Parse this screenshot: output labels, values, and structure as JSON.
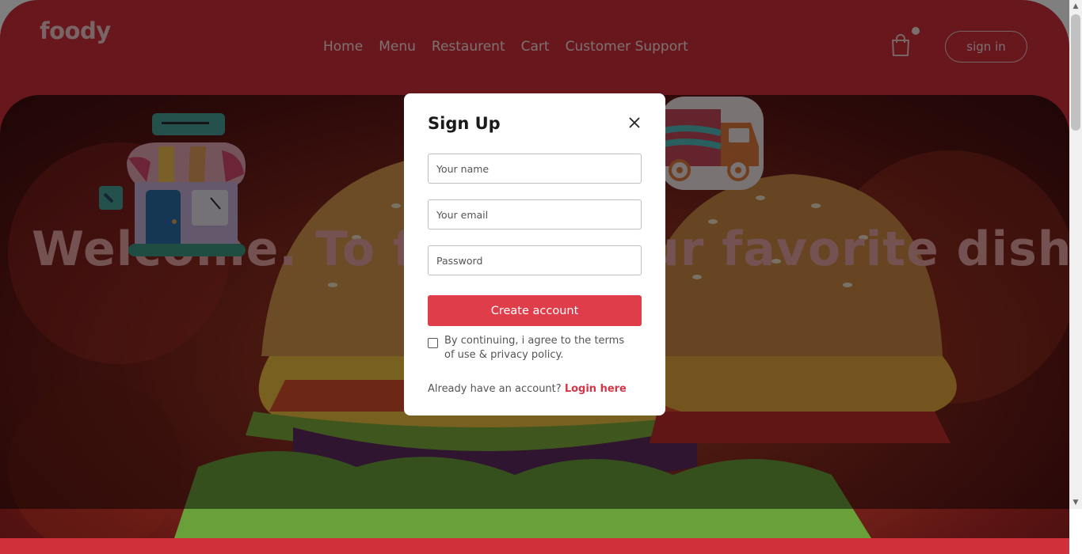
{
  "header": {
    "logo": "foody",
    "nav": [
      "Home",
      "Menu",
      "Restaurent",
      "Cart",
      "Customer Support"
    ],
    "signin_label": "sign in"
  },
  "hero": {
    "title": "Welcome. To foody, your favorite dishes"
  },
  "modal": {
    "title": "Sign Up",
    "name_placeholder": "Your name",
    "email_placeholder": "Your email",
    "password_placeholder": "Password",
    "create_label": "Create account",
    "terms_text": "By continuing, i agree to the terms of use & privacy policy.",
    "already_text": "Already have an account?",
    "login_label": "Login here"
  },
  "colors": {
    "brand_red": "#d0303a",
    "button_red": "#e03d4a",
    "link_red": "#d63545"
  },
  "icons": {
    "cart": "shopping-bag-icon",
    "close": "close-icon",
    "store": "store-illustration",
    "truck": "delivery-truck-illustration"
  }
}
